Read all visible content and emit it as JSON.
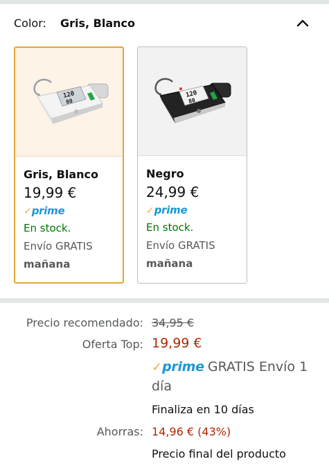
{
  "variation": {
    "label": "Color:",
    "selected_value": "Gris, Blanco"
  },
  "options": [
    {
      "name": "Gris, Blanco",
      "price": "19,99 €",
      "prime_check": "✓",
      "prime_text": "prime",
      "stock": "En stock.",
      "shipping": "Envío GRATIS",
      "shipping_day": "mañana",
      "selected": true
    },
    {
      "name": "Negro",
      "price": "24,99 €",
      "prime_check": "✓",
      "prime_text": "prime",
      "stock": "En stock.",
      "shipping": "Envío GRATIS",
      "shipping_day": "mañana",
      "selected": false
    }
  ],
  "pricing": {
    "list_label": "Precio recomendado:",
    "list_price": "34,95 €",
    "deal_label": "Oferta Top:",
    "deal_price": "19,99 €",
    "prime_check": "✓",
    "prime_text": "prime",
    "prime_delivery": "GRATIS Envío 1 día",
    "deal_ends": "Finaliza en 10 días",
    "savings_label": "Ahorras:",
    "savings_value": "14,96 € (43%)",
    "final_note": "Precio final del producto"
  },
  "colors": {
    "selected_border": "#e3a53b",
    "deal_red": "#b12704",
    "in_stock_green": "#007600",
    "prime_blue": "#1a98d5",
    "prime_orange": "#f3a847"
  },
  "icons": {
    "collapse": "chevron-up-icon",
    "product_white": "blood-pressure-monitor-white",
    "product_black": "blood-pressure-monitor-black"
  }
}
